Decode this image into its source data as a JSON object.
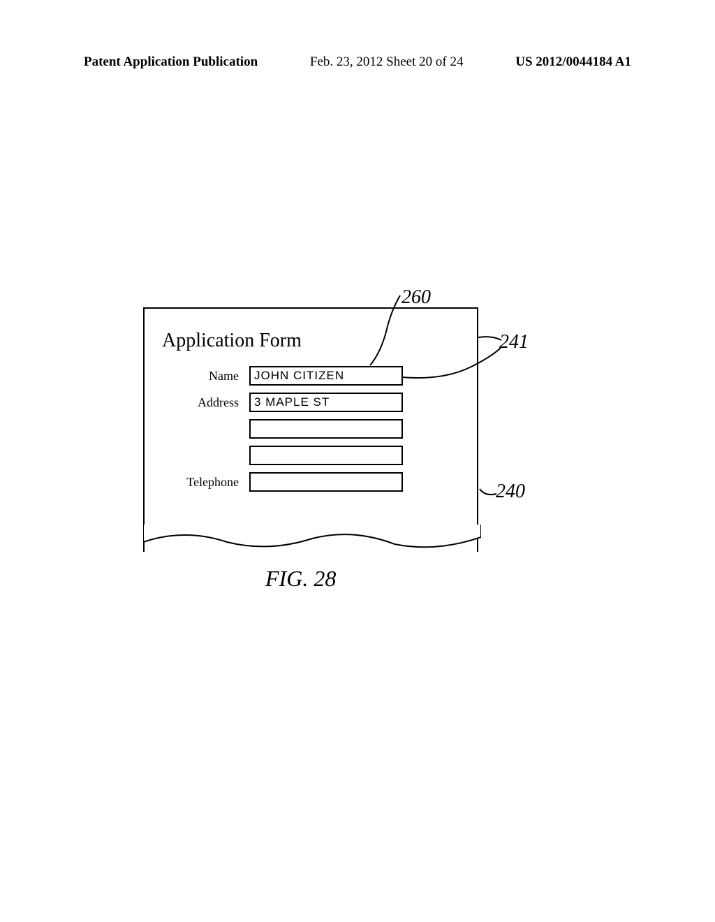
{
  "header": {
    "left": "Patent Application Publication",
    "center": "Feb. 23, 2012  Sheet 20 of 24",
    "right": "US 2012/0044184 A1"
  },
  "form": {
    "title": "Application Form",
    "fields": {
      "name": {
        "label": "Name",
        "value": "JOHN CITIZEN"
      },
      "address": {
        "label": "Address",
        "value": "3 MAPLE ST"
      },
      "address2": {
        "label": "",
        "value": ""
      },
      "address3": {
        "label": "",
        "value": ""
      },
      "telephone": {
        "label": "Telephone",
        "value": ""
      }
    }
  },
  "callouts": {
    "c260": "260",
    "c241": "241",
    "c240": "240"
  },
  "caption": "FIG. 28"
}
